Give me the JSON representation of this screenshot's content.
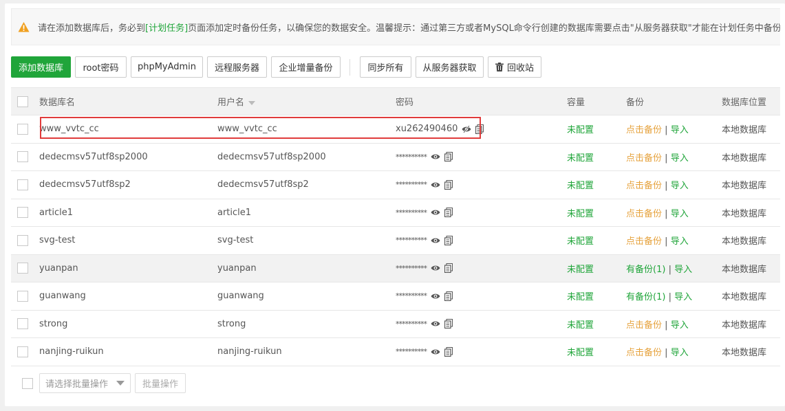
{
  "notice": {
    "part1": "请在添加数据库后，务必到",
    "link": "[计划任务]",
    "part2": "页面添加定时备份任务，以确保您的数据安全。温馨提示：通过第三方或者MySQL命令行创建的数据库需要点击\"从服务器获取\"才能在计划任务中备份"
  },
  "toolbar": {
    "add_db": "添加数据库",
    "root_pw": "root密码",
    "phpmyadmin": "phpMyAdmin",
    "remote": "远程服务器",
    "enterprise": "企业增量备份",
    "sync_all": "同步所有",
    "from_server": "从服务器获取",
    "recycle": "回收站"
  },
  "columns": {
    "name": "数据库名",
    "user": "用户名",
    "password": "密码",
    "capacity": "容量",
    "backup": "备份",
    "location": "数据库位置"
  },
  "rows": [
    {
      "name": "www_vvtc_cc",
      "user": "www_vvtc_cc",
      "password": "xu262490460",
      "capacity": "未配置",
      "backup": "点击备份",
      "import": "导入",
      "location": "本地数据库"
    },
    {
      "name": "dedecmsv57utf8sp2000",
      "user": "dedecmsv57utf8sp2000",
      "password": "**********",
      "capacity": "未配置",
      "backup": "点击备份",
      "import": "导入",
      "location": "本地数据库"
    },
    {
      "name": "dedecmsv57utf8sp2",
      "user": "dedecmsv57utf8sp2",
      "password": "**********",
      "capacity": "未配置",
      "backup": "点击备份",
      "import": "导入",
      "location": "本地数据库"
    },
    {
      "name": "article1",
      "user": "article1",
      "password": "**********",
      "capacity": "未配置",
      "backup": "点击备份",
      "import": "导入",
      "location": "本地数据库"
    },
    {
      "name": "svg-test",
      "user": "svg-test",
      "password": "**********",
      "capacity": "未配置",
      "backup": "点击备份",
      "import": "导入",
      "location": "本地数据库"
    },
    {
      "name": "yuanpan",
      "user": "yuanpan",
      "password": "**********",
      "capacity": "未配置",
      "backup": "有备份(1)",
      "import": "导入",
      "location": "本地数据库"
    },
    {
      "name": "guanwang",
      "user": "guanwang",
      "password": "**********",
      "capacity": "未配置",
      "backup": "有备份(1)",
      "import": "导入",
      "location": "本地数据库"
    },
    {
      "name": "strong",
      "user": "strong",
      "password": "**********",
      "capacity": "未配置",
      "backup": "点击备份",
      "import": "导入",
      "location": "本地数据库"
    },
    {
      "name": "nanjing-ruikun",
      "user": "nanjing-ruikun",
      "password": "**********",
      "capacity": "未配置",
      "backup": "点击备份",
      "import": "导入",
      "location": "本地数据库"
    }
  ],
  "footer": {
    "batch_placeholder": "请选择批量操作",
    "batch_button": "批量操作"
  },
  "colors": {
    "accent": "#20a53a",
    "backup_link": "#e6a23c",
    "highlight_box": "#e03b3b"
  },
  "icons": [
    "warning-icon",
    "trash-icon",
    "eye-icon",
    "eye-slash-icon",
    "copy-icon",
    "sort-caret-icon",
    "dropdown-caret-icon"
  ]
}
